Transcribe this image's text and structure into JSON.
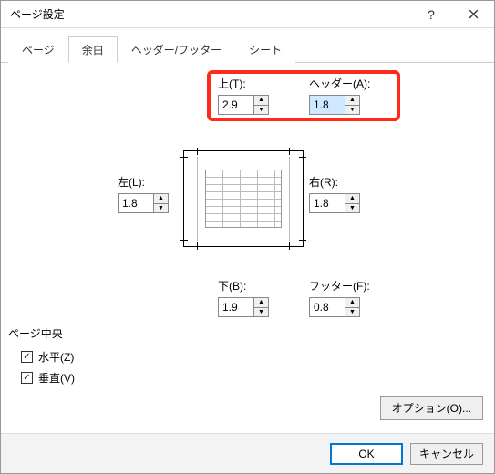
{
  "title": "ページ設定",
  "tabs": {
    "page": "ページ",
    "margins": "余白",
    "headerfooter": "ヘッダー/フッター",
    "sheet": "シート"
  },
  "margins": {
    "top": {
      "label": "上(T):",
      "value": "2.9"
    },
    "header": {
      "label": "ヘッダー(A):",
      "value": "1.8"
    },
    "left": {
      "label": "左(L):",
      "value": "1.8"
    },
    "right": {
      "label": "右(R):",
      "value": "1.8"
    },
    "bottom": {
      "label": "下(B):",
      "value": "1.9"
    },
    "footer": {
      "label": "フッター(F):",
      "value": "0.8"
    }
  },
  "center": {
    "group_label": "ページ中央",
    "horizontal": "水平(Z)",
    "vertical": "垂直(V)"
  },
  "buttons": {
    "options": "オプション(O)...",
    "ok": "OK",
    "cancel": "キャンセル"
  }
}
